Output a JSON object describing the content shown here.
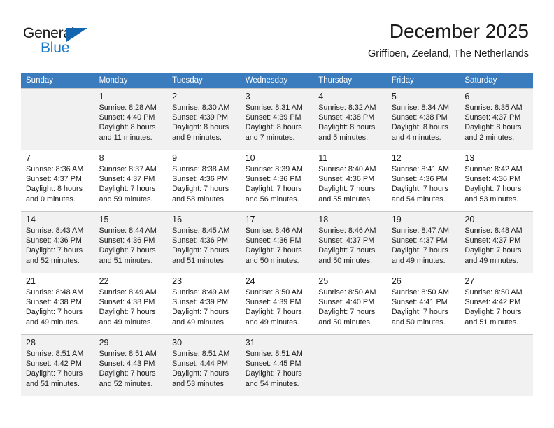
{
  "brand": {
    "name_part1": "General",
    "name_part2": "Blue",
    "accent_color": "#1266b0",
    "logo_icon": "triangle-icon"
  },
  "header": {
    "title": "December 2025",
    "subtitle": "Griffioen, Zeeland, The Netherlands"
  },
  "calendar": {
    "header_bg": "#3a7cbe",
    "shaded_row_bg": "#f1f1f1",
    "weekdays": [
      "Sunday",
      "Monday",
      "Tuesday",
      "Wednesday",
      "Thursday",
      "Friday",
      "Saturday"
    ],
    "weeks": [
      {
        "shaded": true,
        "days": [
          {
            "num": "",
            "sunrise": "",
            "sunset": "",
            "daylight_line1": "",
            "daylight_line2": ""
          },
          {
            "num": "1",
            "sunrise": "Sunrise: 8:28 AM",
            "sunset": "Sunset: 4:40 PM",
            "daylight_line1": "Daylight: 8 hours",
            "daylight_line2": "and 11 minutes."
          },
          {
            "num": "2",
            "sunrise": "Sunrise: 8:30 AM",
            "sunset": "Sunset: 4:39 PM",
            "daylight_line1": "Daylight: 8 hours",
            "daylight_line2": "and 9 minutes."
          },
          {
            "num": "3",
            "sunrise": "Sunrise: 8:31 AM",
            "sunset": "Sunset: 4:39 PM",
            "daylight_line1": "Daylight: 8 hours",
            "daylight_line2": "and 7 minutes."
          },
          {
            "num": "4",
            "sunrise": "Sunrise: 8:32 AM",
            "sunset": "Sunset: 4:38 PM",
            "daylight_line1": "Daylight: 8 hours",
            "daylight_line2": "and 5 minutes."
          },
          {
            "num": "5",
            "sunrise": "Sunrise: 8:34 AM",
            "sunset": "Sunset: 4:38 PM",
            "daylight_line1": "Daylight: 8 hours",
            "daylight_line2": "and 4 minutes."
          },
          {
            "num": "6",
            "sunrise": "Sunrise: 8:35 AM",
            "sunset": "Sunset: 4:37 PM",
            "daylight_line1": "Daylight: 8 hours",
            "daylight_line2": "and 2 minutes."
          }
        ]
      },
      {
        "shaded": false,
        "days": [
          {
            "num": "7",
            "sunrise": "Sunrise: 8:36 AM",
            "sunset": "Sunset: 4:37 PM",
            "daylight_line1": "Daylight: 8 hours",
            "daylight_line2": "and 0 minutes."
          },
          {
            "num": "8",
            "sunrise": "Sunrise: 8:37 AM",
            "sunset": "Sunset: 4:37 PM",
            "daylight_line1": "Daylight: 7 hours",
            "daylight_line2": "and 59 minutes."
          },
          {
            "num": "9",
            "sunrise": "Sunrise: 8:38 AM",
            "sunset": "Sunset: 4:36 PM",
            "daylight_line1": "Daylight: 7 hours",
            "daylight_line2": "and 58 minutes."
          },
          {
            "num": "10",
            "sunrise": "Sunrise: 8:39 AM",
            "sunset": "Sunset: 4:36 PM",
            "daylight_line1": "Daylight: 7 hours",
            "daylight_line2": "and 56 minutes."
          },
          {
            "num": "11",
            "sunrise": "Sunrise: 8:40 AM",
            "sunset": "Sunset: 4:36 PM",
            "daylight_line1": "Daylight: 7 hours",
            "daylight_line2": "and 55 minutes."
          },
          {
            "num": "12",
            "sunrise": "Sunrise: 8:41 AM",
            "sunset": "Sunset: 4:36 PM",
            "daylight_line1": "Daylight: 7 hours",
            "daylight_line2": "and 54 minutes."
          },
          {
            "num": "13",
            "sunrise": "Sunrise: 8:42 AM",
            "sunset": "Sunset: 4:36 PM",
            "daylight_line1": "Daylight: 7 hours",
            "daylight_line2": "and 53 minutes."
          }
        ]
      },
      {
        "shaded": true,
        "days": [
          {
            "num": "14",
            "sunrise": "Sunrise: 8:43 AM",
            "sunset": "Sunset: 4:36 PM",
            "daylight_line1": "Daylight: 7 hours",
            "daylight_line2": "and 52 minutes."
          },
          {
            "num": "15",
            "sunrise": "Sunrise: 8:44 AM",
            "sunset": "Sunset: 4:36 PM",
            "daylight_line1": "Daylight: 7 hours",
            "daylight_line2": "and 51 minutes."
          },
          {
            "num": "16",
            "sunrise": "Sunrise: 8:45 AM",
            "sunset": "Sunset: 4:36 PM",
            "daylight_line1": "Daylight: 7 hours",
            "daylight_line2": "and 51 minutes."
          },
          {
            "num": "17",
            "sunrise": "Sunrise: 8:46 AM",
            "sunset": "Sunset: 4:36 PM",
            "daylight_line1": "Daylight: 7 hours",
            "daylight_line2": "and 50 minutes."
          },
          {
            "num": "18",
            "sunrise": "Sunrise: 8:46 AM",
            "sunset": "Sunset: 4:37 PM",
            "daylight_line1": "Daylight: 7 hours",
            "daylight_line2": "and 50 minutes."
          },
          {
            "num": "19",
            "sunrise": "Sunrise: 8:47 AM",
            "sunset": "Sunset: 4:37 PM",
            "daylight_line1": "Daylight: 7 hours",
            "daylight_line2": "and 49 minutes."
          },
          {
            "num": "20",
            "sunrise": "Sunrise: 8:48 AM",
            "sunset": "Sunset: 4:37 PM",
            "daylight_line1": "Daylight: 7 hours",
            "daylight_line2": "and 49 minutes."
          }
        ]
      },
      {
        "shaded": false,
        "days": [
          {
            "num": "21",
            "sunrise": "Sunrise: 8:48 AM",
            "sunset": "Sunset: 4:38 PM",
            "daylight_line1": "Daylight: 7 hours",
            "daylight_line2": "and 49 minutes."
          },
          {
            "num": "22",
            "sunrise": "Sunrise: 8:49 AM",
            "sunset": "Sunset: 4:38 PM",
            "daylight_line1": "Daylight: 7 hours",
            "daylight_line2": "and 49 minutes."
          },
          {
            "num": "23",
            "sunrise": "Sunrise: 8:49 AM",
            "sunset": "Sunset: 4:39 PM",
            "daylight_line1": "Daylight: 7 hours",
            "daylight_line2": "and 49 minutes."
          },
          {
            "num": "24",
            "sunrise": "Sunrise: 8:50 AM",
            "sunset": "Sunset: 4:39 PM",
            "daylight_line1": "Daylight: 7 hours",
            "daylight_line2": "and 49 minutes."
          },
          {
            "num": "25",
            "sunrise": "Sunrise: 8:50 AM",
            "sunset": "Sunset: 4:40 PM",
            "daylight_line1": "Daylight: 7 hours",
            "daylight_line2": "and 50 minutes."
          },
          {
            "num": "26",
            "sunrise": "Sunrise: 8:50 AM",
            "sunset": "Sunset: 4:41 PM",
            "daylight_line1": "Daylight: 7 hours",
            "daylight_line2": "and 50 minutes."
          },
          {
            "num": "27",
            "sunrise": "Sunrise: 8:50 AM",
            "sunset": "Sunset: 4:42 PM",
            "daylight_line1": "Daylight: 7 hours",
            "daylight_line2": "and 51 minutes."
          }
        ]
      },
      {
        "shaded": true,
        "days": [
          {
            "num": "28",
            "sunrise": "Sunrise: 8:51 AM",
            "sunset": "Sunset: 4:42 PM",
            "daylight_line1": "Daylight: 7 hours",
            "daylight_line2": "and 51 minutes."
          },
          {
            "num": "29",
            "sunrise": "Sunrise: 8:51 AM",
            "sunset": "Sunset: 4:43 PM",
            "daylight_line1": "Daylight: 7 hours",
            "daylight_line2": "and 52 minutes."
          },
          {
            "num": "30",
            "sunrise": "Sunrise: 8:51 AM",
            "sunset": "Sunset: 4:44 PM",
            "daylight_line1": "Daylight: 7 hours",
            "daylight_line2": "and 53 minutes."
          },
          {
            "num": "31",
            "sunrise": "Sunrise: 8:51 AM",
            "sunset": "Sunset: 4:45 PM",
            "daylight_line1": "Daylight: 7 hours",
            "daylight_line2": "and 54 minutes."
          },
          {
            "num": "",
            "sunrise": "",
            "sunset": "",
            "daylight_line1": "",
            "daylight_line2": ""
          },
          {
            "num": "",
            "sunrise": "",
            "sunset": "",
            "daylight_line1": "",
            "daylight_line2": ""
          },
          {
            "num": "",
            "sunrise": "",
            "sunset": "",
            "daylight_line1": "",
            "daylight_line2": ""
          }
        ]
      }
    ]
  }
}
